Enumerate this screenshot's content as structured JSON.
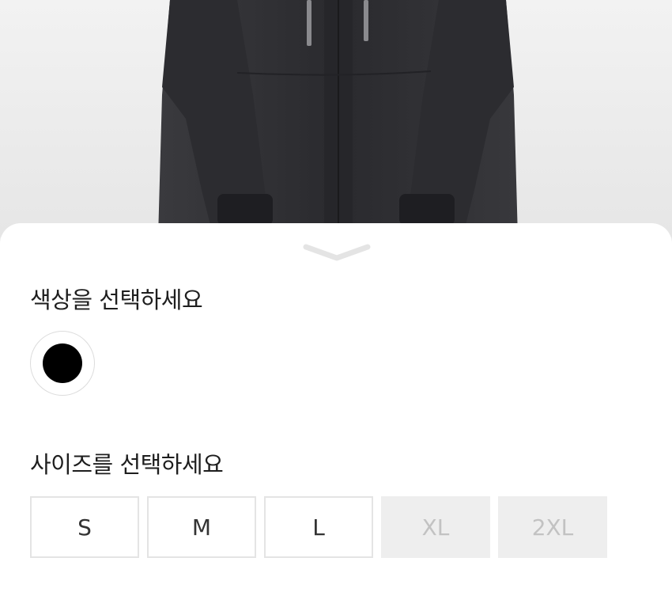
{
  "color_section": {
    "title": "색상을 선택하세요",
    "options": [
      {
        "name": "black",
        "hex": "#000000",
        "selected": true
      }
    ]
  },
  "size_section": {
    "title": "사이즈를 선택하세요",
    "options": [
      {
        "label": "S",
        "available": true
      },
      {
        "label": "M",
        "available": true
      },
      {
        "label": "L",
        "available": true
      },
      {
        "label": "XL",
        "available": false
      },
      {
        "label": "2XL",
        "available": false
      }
    ]
  },
  "icons": {
    "sheet_handle": "chevron-down-icon"
  },
  "colors": {
    "sheet_background": "#ffffff",
    "border": "#e4e4e4",
    "disabled_background": "#eeeeee",
    "disabled_text": "#c2c2c2",
    "text": "#1e1e1e"
  }
}
